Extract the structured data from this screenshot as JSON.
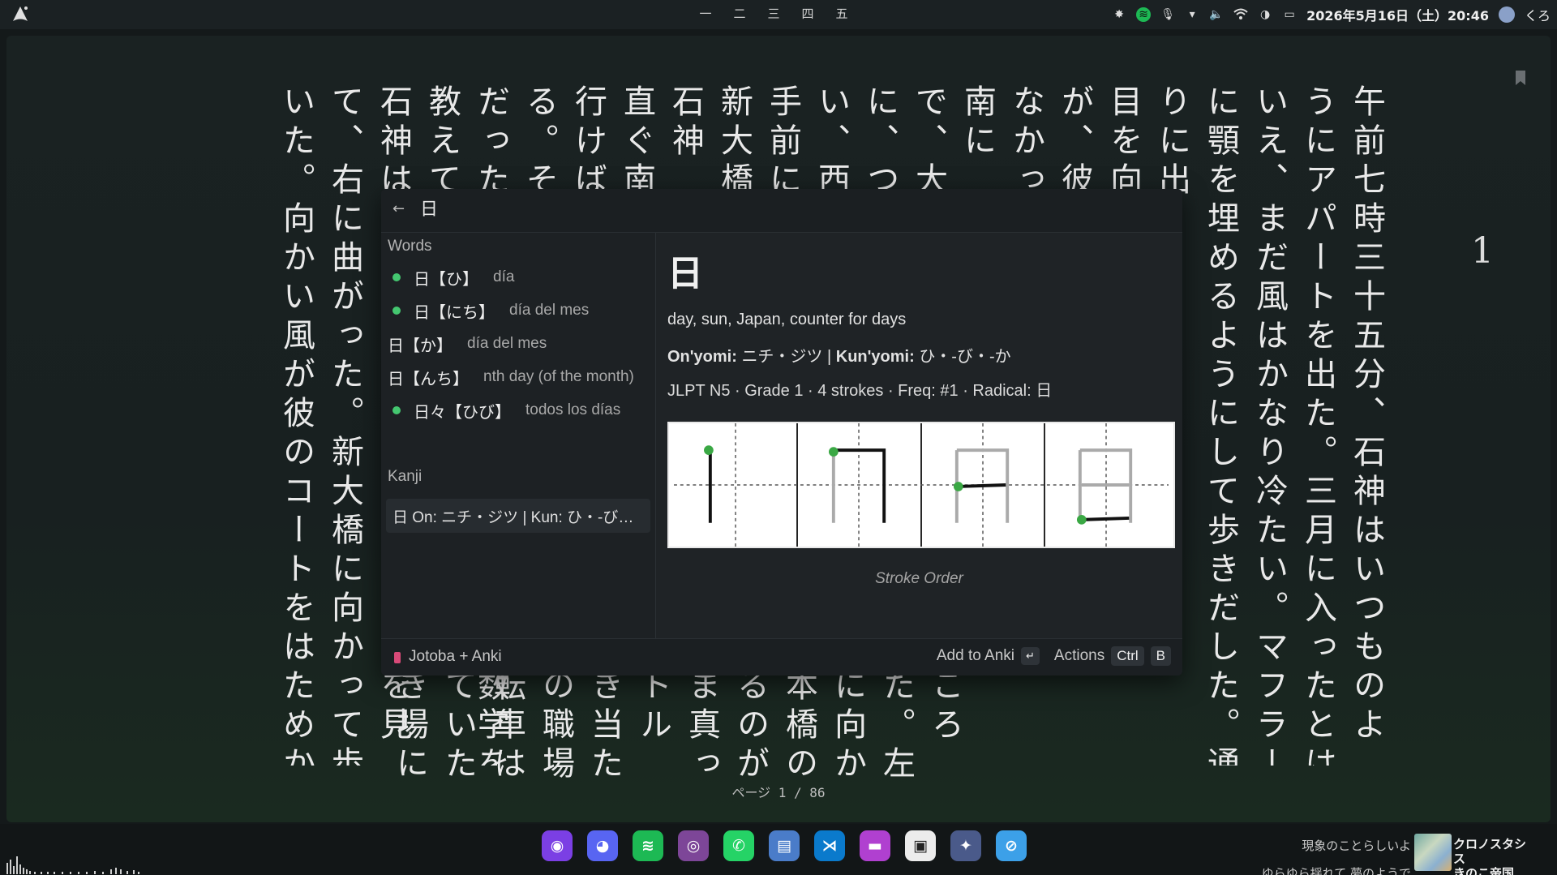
{
  "topbar": {
    "workspaces": [
      "一",
      "二",
      "三",
      "四",
      "五"
    ],
    "clock": "2026年5月16日（土）20:46",
    "user": "くろ",
    "icons": [
      "arch-logo",
      "settings-icon",
      "spotify-icon",
      "microphone-icon",
      "chevron-down-icon",
      "volume-icon",
      "wifi-icon",
      "vpn-icon",
      "keyboard-icon",
      "user-avatar"
    ]
  },
  "reader": {
    "columns": [
      "午前七時三十五分、石神はいつものよ",
      "うにアパートを出た。三月に入ったとは",
      "いえ、まだ風はかなり冷たい。マフラー",
      "に顎を埋めるようにして歩きだした。通",
      "りに出",
      "目を向",
      "が、彼",
      "なかっ",
      "南に",
      "で、大",
      "に、つ",
      "い、西",
      "手前に",
      "新大橋",
      "石神",
      "直ぐ南",
      "行けば",
      "る。そ",
      "だった。つまり彼は教師だった。数学を",
      "教えている。",
      "石神は目の前の信号が赤になるのを見",
      "て、右に曲がった。新大橋に向かって歩",
      "いた。向かい風が彼のコートをはためか"
    ],
    "bottom_fragments": [
      "ころ",
      "た。左",
      "に向か",
      "本橋の",
      "るのが",
      "ま真っ",
      "トル",
      "き当た",
      "の職場",
      "転車は",
      "ていた",
      "き場に"
    ],
    "page_number": "1",
    "page_indicator": "ページ 1 / 86"
  },
  "popup": {
    "query": "日",
    "words_heading": "Words",
    "words": [
      {
        "term": "日【ひ】",
        "def": "día",
        "dot": true
      },
      {
        "term": "日【にち】",
        "def": "día del mes",
        "dot": true
      },
      {
        "term": "日【か】",
        "def": "día del mes",
        "dot": false
      },
      {
        "term": "日【んち】",
        "def": "nth day (of the month)",
        "dot": false
      },
      {
        "term": "日々【ひび】",
        "def": "todos los días",
        "dot": true
      }
    ],
    "kanji_heading": "Kanji",
    "kanji_item": "日 On: ニチ・ジツ | Kun: ひ・-び…",
    "detail": {
      "kanji": "日",
      "meaning": "day, sun, Japan, counter for days",
      "onyomi_label": "On'yomi:",
      "onyomi": "ニチ・ジツ",
      "separator": "|",
      "kunyomi_label": "Kun'yomi:",
      "kunyomi": "ひ・-び・-か",
      "meta": "JLPT N5 · Grade 1 · 4 strokes · Freq: #1 · Radical: 日",
      "stroke_caption": "Stroke Order"
    },
    "footer": {
      "app_name": "Jotoba + Anki",
      "add_label": "Add to Anki",
      "enter_key": "↵",
      "actions_label": "Actions",
      "ctrl_key": "Ctrl",
      "b_key": "B"
    }
  },
  "dock": {
    "items": [
      {
        "name": "firefox",
        "glyph": "◉",
        "color": "#7b3fe4"
      },
      {
        "name": "discord",
        "glyph": "◕",
        "color": "#5865f2"
      },
      {
        "name": "spotify",
        "glyph": "≋",
        "color": "#1db954"
      },
      {
        "name": "tor",
        "glyph": "◎",
        "color": "#7d4698"
      },
      {
        "name": "whatsapp",
        "glyph": "✆",
        "color": "#25d366"
      },
      {
        "name": "files",
        "glyph": "▤",
        "color": "#4a7cc9"
      },
      {
        "name": "vscode",
        "glyph": "⋊",
        "color": "#0a7acc"
      },
      {
        "name": "terminal",
        "glyph": "▬",
        "color": "#b040d0"
      },
      {
        "name": "notes",
        "glyph": "▣",
        "color": "#ececec"
      },
      {
        "name": "launcher",
        "glyph": "✦",
        "color": "#4a5a8a"
      },
      {
        "name": "browser",
        "glyph": "⊘",
        "color": "#3ca0e8"
      }
    ]
  },
  "now_playing": {
    "lyric1": "現象のことらしいよ",
    "lyric2": "ゆらゆら揺れて 夢のようで",
    "title": "クロノスタシス",
    "artist": "きのこ帝国"
  }
}
